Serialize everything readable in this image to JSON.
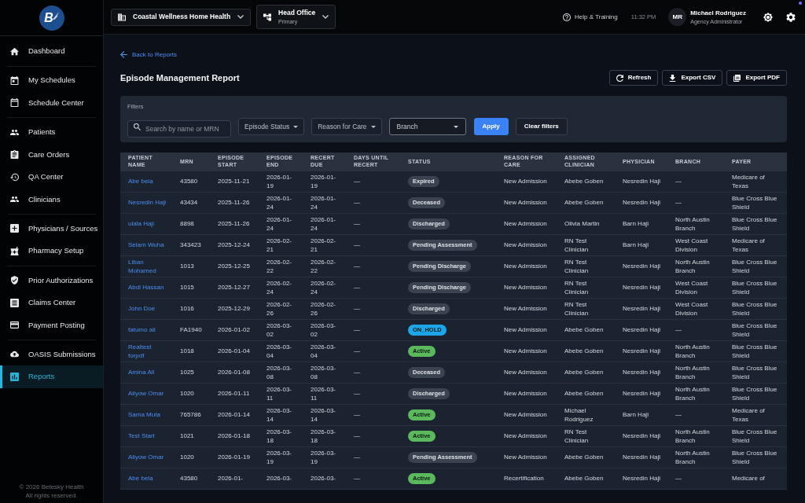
{
  "sidebar": {
    "logo": {
      "letter": "B"
    },
    "sections": [
      {
        "items": [
          {
            "label": "Dashboard",
            "selected": false
          }
        ]
      },
      {
        "items": [
          {
            "label": "My Schedules",
            "selected": false
          },
          {
            "label": "Schedule Center",
            "selected": false
          }
        ]
      },
      {
        "items": [
          {
            "label": "Patients",
            "selected": false
          },
          {
            "label": "Care Orders",
            "selected": false
          },
          {
            "label": "QA Center",
            "selected": false
          },
          {
            "label": "Clinicians",
            "selected": false
          }
        ]
      },
      {
        "items": [
          {
            "label": "Physicians / Sources",
            "selected": false
          },
          {
            "label": "Pharmacy Setup",
            "selected": false
          }
        ]
      },
      {
        "items": [
          {
            "label": "Prior Authorizations",
            "selected": false
          },
          {
            "label": "Claims Center",
            "selected": false
          },
          {
            "label": "Payment Posting",
            "selected": false
          }
        ]
      },
      {
        "items": [
          {
            "label": "OASIS Submissions",
            "selected": false
          },
          {
            "label": "Reports",
            "selected": true
          }
        ]
      }
    ],
    "footer": [
      "© 2026 Betesky Health",
      "All rights reserved."
    ]
  },
  "top_bar": {
    "organization": "Coastal Wellness Home Health",
    "branch": {
      "name": "Head Office",
      "subtitle": "Primary"
    },
    "help": "Help & Training",
    "time": "11:32 PM",
    "user": {
      "initials": "MR",
      "name": "Michael Rodriguez",
      "role": "Agency Administrator"
    }
  },
  "back_link": "Back to Reports",
  "title": "Episode Management Report",
  "actions": [
    "Refresh",
    "Export CSV",
    "Export PDF"
  ],
  "filters": {
    "title": "Filters",
    "search": {
      "placeholder": "Search by name or MRN"
    },
    "dropdowns": [
      {
        "label": "Episode Status",
        "kind": "menu"
      },
      {
        "label": "Reason for Care",
        "kind": "menu"
      },
      {
        "label": "Branch",
        "kind": "select"
      }
    ],
    "buttons": [
      {
        "label": "Apply",
        "kind": "primary"
      },
      {
        "label": "Clear filters",
        "kind": "secondary"
      }
    ]
  },
  "table": {
    "columns": [
      "PATIENT NAME",
      "MRN",
      "EPISODE START",
      "EPISODE END",
      "RECERT DUE",
      "DAYS UNTIL RECERT",
      "STATUS",
      "REASON FOR CARE",
      "ASSIGNED CLINICIAN",
      "PHYSICIAN",
      "BRANCH",
      "PAYER"
    ],
    "rows": [
      {
        "patient_name": "Abe bela",
        "mrn": "43580",
        "episode_start": "2025-11-21",
        "episode_end": "2026-01-19",
        "recert_due": "2026-01-19",
        "days_until_recert": "—",
        "status": {
          "label": "Expired",
          "color": "#3c4350"
        },
        "reason_for_care": "New Admission",
        "assigned_clinician": "Abebe Goben",
        "physician": "Nesredin Haji",
        "branch": "—",
        "payer": "Medicare of Texas"
      },
      {
        "patient_name": "Nesredin Haji",
        "mrn": "43434",
        "episode_start": "2025-11-26",
        "episode_end": "2026-01-24",
        "recert_due": "2026-01-24",
        "days_until_recert": "—",
        "status": {
          "label": "Deceased",
          "color": "#3c4350"
        },
        "reason_for_care": "New Admission",
        "assigned_clinician": "Abebe Goben",
        "physician": "Nesredin Haji",
        "branch": "—",
        "payer": "Blue Cross Blue Shield"
      },
      {
        "patient_name": "ulala Haji",
        "mrn": "8898",
        "episode_start": "2025-11-26",
        "episode_end": "2026-01-24",
        "recert_due": "2026-01-24",
        "days_until_recert": "—",
        "status": {
          "label": "Discharged",
          "color": "#3c4350"
        },
        "reason_for_care": "New Admission",
        "assigned_clinician": "Olivia Martin",
        "physician": "Barn Haji",
        "branch": "North Austin Branch",
        "payer": "Blue Cross Blue Shield"
      },
      {
        "patient_name": "Selam Wuha",
        "mrn": "343423",
        "episode_start": "2025-12-24",
        "episode_end": "2026-02-21",
        "recert_due": "2026-02-21",
        "days_until_recert": "—",
        "status": {
          "label": "Pending Assessment",
          "color": "#3c4350"
        },
        "reason_for_care": "New Admission",
        "assigned_clinician": "RN Test Clinician",
        "physician": "Barn Haji",
        "branch": "West Coast Division",
        "payer": "Medicare of Texas"
      },
      {
        "patient_name": "Liban Mohamed",
        "mrn": "1013",
        "episode_start": "2025-12-25",
        "episode_end": "2026-02-22",
        "recert_due": "2026-02-22",
        "days_until_recert": "—",
        "status": {
          "label": "Pending Discharge",
          "color": "#3c4350"
        },
        "reason_for_care": "New Admission",
        "assigned_clinician": "RN Test Clinician",
        "physician": "Nesredin Haji",
        "branch": "North Austin Branch",
        "payer": "Blue Cross Blue Shield"
      },
      {
        "patient_name": "Abdi Hassan",
        "mrn": "1015",
        "episode_start": "2025-12-27",
        "episode_end": "2026-02-24",
        "recert_due": "2026-02-24",
        "days_until_recert": "—",
        "status": {
          "label": "Pending Discharge",
          "color": "#3c4350"
        },
        "reason_for_care": "New Admission",
        "assigned_clinician": "RN Test Clinician",
        "physician": "Nesredin Haji",
        "branch": "West Coast Division",
        "payer": "Blue Cross Blue Shield"
      },
      {
        "patient_name": "John Doe",
        "mrn": "1016",
        "episode_start": "2025-12-29",
        "episode_end": "2026-02-26",
        "recert_due": "2026-02-26",
        "days_until_recert": "—",
        "status": {
          "label": "Discharged",
          "color": "#3c4350"
        },
        "reason_for_care": "New Admission",
        "assigned_clinician": "RN Test Clinician",
        "physician": "Nesredin Haji",
        "branch": "West Coast Division",
        "payer": "Blue Cross Blue Shield"
      },
      {
        "patient_name": "fatumo ali",
        "mrn": "FA1940",
        "episode_start": "2026-01-02",
        "episode_end": "2026-03-02",
        "recert_due": "2026-03-02",
        "days_until_recert": "—",
        "status": {
          "label": "ON_HOLD",
          "color": "#1ea6ea"
        },
        "reason_for_care": "New Admission",
        "assigned_clinician": "Abebe Goben",
        "physician": "Nesredin Haji",
        "branch": "—",
        "payer": "Blue Cross Blue Shield"
      },
      {
        "patient_name": "Realtest forpdf",
        "mrn": "1018",
        "episode_start": "2026-01-04",
        "episode_end": "2026-03-04",
        "recert_due": "2026-03-04",
        "days_until_recert": "—",
        "status": {
          "label": "Active",
          "color": "#5cb85c"
        },
        "reason_for_care": "New Admission",
        "assigned_clinician": "Abebe Goben",
        "physician": "Nesredin Haji",
        "branch": "North Austin Branch",
        "payer": "Blue Cross Blue Shield"
      },
      {
        "patient_name": "Amina Ali",
        "mrn": "1025",
        "episode_start": "2026-01-08",
        "episode_end": "2026-03-08",
        "recert_due": "2026-03-08",
        "days_until_recert": "—",
        "status": {
          "label": "Deceased",
          "color": "#3c4350"
        },
        "reason_for_care": "New Admission",
        "assigned_clinician": "Abebe Goben",
        "physician": "Nesredin Haji",
        "branch": "North Austin Branch",
        "payer": "Blue Cross Blue Shield"
      },
      {
        "patient_name": "Aliyow Omar",
        "mrn": "1020",
        "episode_start": "2026-01-11",
        "episode_end": "2026-03-11",
        "recert_due": "2026-03-11",
        "days_until_recert": "—",
        "status": {
          "label": "Discharged",
          "color": "#3c4350"
        },
        "reason_for_care": "New Admission",
        "assigned_clinician": "Abebe Goben",
        "physician": "Nesredin Haji",
        "branch": "North Austin Branch",
        "payer": "Blue Cross Blue Shield"
      },
      {
        "patient_name": "Sama Muta",
        "mrn": "765786",
        "episode_start": "2026-01-14",
        "episode_end": "2026-03-14",
        "recert_due": "2026-03-14",
        "days_until_recert": "—",
        "status": {
          "label": "Active",
          "color": "#5cb85c"
        },
        "reason_for_care": "New Admission",
        "assigned_clinician": "Michael Rodriguez",
        "physician": "Barn Haji",
        "branch": "—",
        "payer": "Medicare of Texas"
      },
      {
        "patient_name": "Test Start",
        "mrn": "1021",
        "episode_start": "2026-01-18",
        "episode_end": "2026-03-18",
        "recert_due": "2026-03-18",
        "days_until_recert": "—",
        "status": {
          "label": "Active",
          "color": "#5cb85c"
        },
        "reason_for_care": "New Admission",
        "assigned_clinician": "RN Test Clinician",
        "physician": "Nesredin Haji",
        "branch": "North Austin Branch",
        "payer": "Blue Cross Blue Shield"
      },
      {
        "patient_name": "Aliyow Omar",
        "mrn": "1020",
        "episode_start": "2026-01-19",
        "episode_end": "2026-03-19",
        "recert_due": "2026-03-19",
        "days_until_recert": "—",
        "status": {
          "label": "Pending Assessment",
          "color": "#3c4350"
        },
        "reason_for_care": "New Admission",
        "assigned_clinician": "Abebe Goben",
        "physician": "Nesredin Haji",
        "branch": "North Austin Branch",
        "payer": "Blue Cross Blue Shield"
      },
      {
        "patient_name": "Abe bela",
        "mrn": "43580",
        "episode_start": "2026-01-",
        "episode_end": "2026-03-",
        "recert_due": "2026-03-",
        "days_until_recert": "—",
        "status": {
          "label": "Active",
          "color": "#5cb85c"
        },
        "reason_for_care": "Recertification",
        "assigned_clinician": "Abebe Goben",
        "physician": "Nesredin Haji",
        "branch": "—",
        "payer": "Medicare of"
      }
    ]
  }
}
